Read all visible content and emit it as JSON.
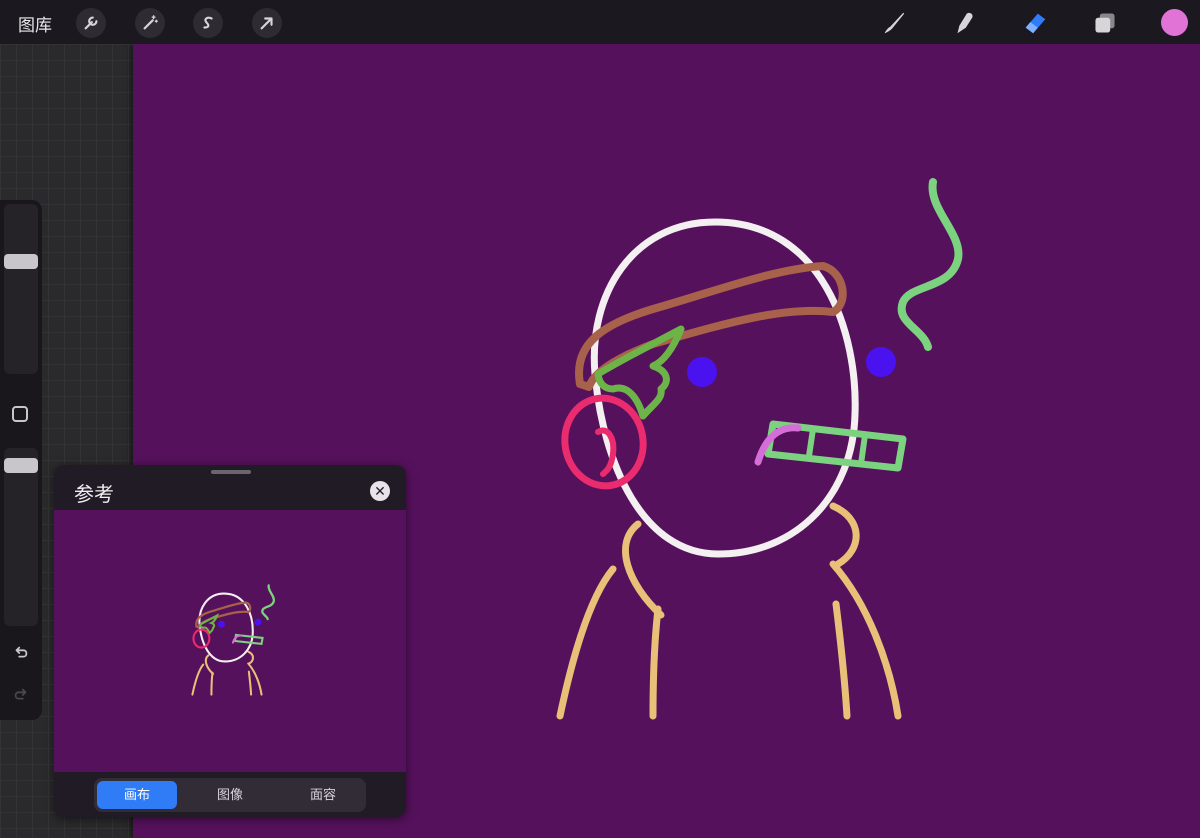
{
  "toolbar": {
    "gallery_label": "图库",
    "left_tools": [
      {
        "name": "actions",
        "icon": "wrench-icon"
      },
      {
        "name": "adjustments",
        "icon": "magic-wand-icon"
      },
      {
        "name": "selection",
        "icon": "selection-s-icon"
      },
      {
        "name": "transform",
        "icon": "arrow-cursor-icon"
      }
    ],
    "right_tools": [
      {
        "name": "brush",
        "icon": "brush-icon"
      },
      {
        "name": "smudge",
        "icon": "smudge-icon"
      },
      {
        "name": "eraser",
        "icon": "eraser-icon",
        "active": true
      },
      {
        "name": "layers",
        "icon": "layers-icon"
      }
    ],
    "current_color": "#e173d6"
  },
  "reference_panel": {
    "title": "参考",
    "tabs": [
      {
        "label": "画布",
        "active": true
      },
      {
        "label": "图像",
        "active": false
      },
      {
        "label": "面容",
        "active": false
      }
    ]
  },
  "canvas": {
    "background_color": "#56115c"
  }
}
